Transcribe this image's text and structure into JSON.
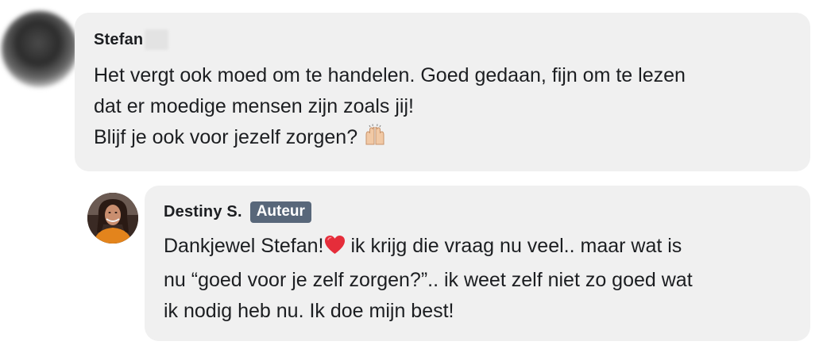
{
  "comments": [
    {
      "author": "Stefan",
      "author_redacted": true,
      "lines": [
        "Het vergt ook moed om te handelen. Goed gedaan, fijn om te lezen",
        "dat er moedige mensen zijn zoals jij!",
        "Blijf je ook voor jezelf zorgen? "
      ],
      "emoji": "raising-hands-emoji"
    },
    {
      "author": "Destiny S.",
      "badge": "Auteur",
      "line1_a": "Dankjewel Stefan!",
      "line1_b": " ik krijg die vraag nu veel.. maar wat is",
      "line2": "nu “goed voor je zelf zorgen?”.. ik weet zelf niet zo goed wat",
      "line3": "ik nodig heb nu. Ik doe mijn best!",
      "emoji": "red-heart-emoji"
    }
  ],
  "colors": {
    "bubble_bg": "#f0f0f0",
    "badge_bg": "#58677a",
    "text": "#1c1e21",
    "heart": "#e0245e"
  }
}
